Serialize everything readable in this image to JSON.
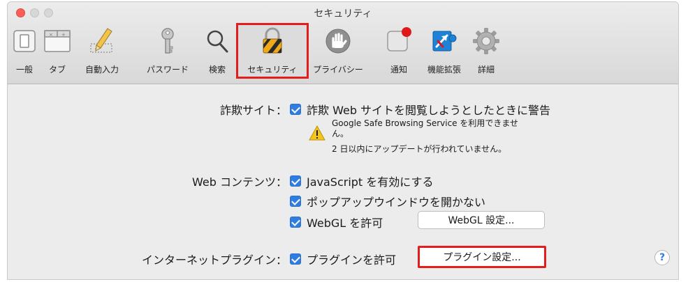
{
  "window": {
    "title": "セキュリティ"
  },
  "toolbar": {
    "items": [
      {
        "label": "一般",
        "icon": "general-switch-icon"
      },
      {
        "label": "タブ",
        "icon": "tabs-icon"
      },
      {
        "label": "自動入力",
        "icon": "pencil-icon"
      },
      {
        "label": "パスワード",
        "icon": "key-icon"
      },
      {
        "label": "検索",
        "icon": "magnifier-icon"
      },
      {
        "label": "セキュリティ",
        "icon": "lock-icon",
        "selected": true
      },
      {
        "label": "プライバシー",
        "icon": "hand-icon"
      },
      {
        "label": "通知",
        "icon": "notification-badge-icon"
      },
      {
        "label": "機能拡張",
        "icon": "puzzle-icon"
      },
      {
        "label": "詳細",
        "icon": "gear-icon"
      }
    ]
  },
  "fraud": {
    "label": "詐欺サイト：",
    "checkbox_label": "詐欺 Web サイトを閲覧しようとしたときに警告",
    "checked": true,
    "warning_line1": "Google Safe Browsing Service を利用できませ",
    "warning_line2": "ん。",
    "warning_line3": "2 日以内にアップデートが行われていません。"
  },
  "web_content": {
    "label": "Web コンテンツ：",
    "javascript_label": "JavaScript を有効にする",
    "popup_label": "ポップアップウインドウを開かない",
    "webgl_label": "WebGL を許可",
    "webgl_button": "WebGL 設定..."
  },
  "plugins": {
    "label": "インターネットプラグイン：",
    "checkbox_label": "プラグインを許可",
    "button": "プラグイン設定..."
  },
  "help": {
    "label": "?"
  },
  "colors": {
    "accent": "#2f7de1",
    "highlight": "#e31c1c",
    "close": "#fc5f57"
  }
}
